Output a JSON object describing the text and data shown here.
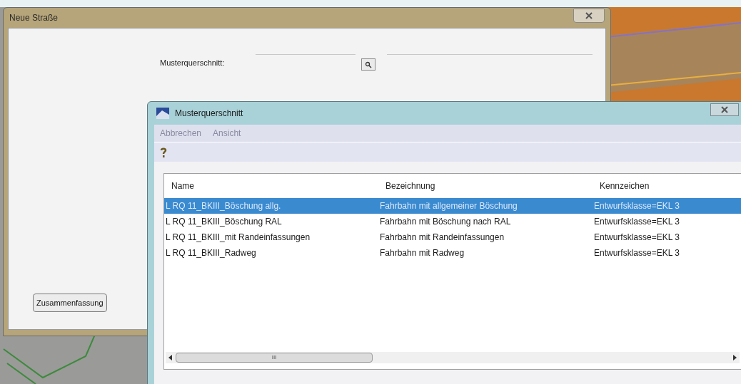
{
  "main_window": {
    "title": "Neue Straße",
    "field_label": "Musterquerschnitt:",
    "summary_button": "Zusammenfassung"
  },
  "dialog": {
    "title": "Musterquerschnitt",
    "menu": [
      "Abbrechen",
      "Ansicht"
    ],
    "table": {
      "columns": [
        "Name",
        "Bezeichnung",
        "Kennzeichen"
      ],
      "rows": [
        {
          "cells": [
            "L RQ 11_BKIII_Böschung allg.",
            "Fahrbahn mit allgemeiner Böschung",
            "Entwurfsklasse=EKL 3"
          ],
          "selected": true
        },
        {
          "cells": [
            "L RQ 11_BKIII_Böschung RAL",
            "Fahrbahn mit Böschung nach RAL",
            "Entwurfsklasse=EKL 3"
          ],
          "selected": false
        },
        {
          "cells": [
            "L RQ 11_BKIII_mit Randeinfassungen",
            "Fahrbahn mit Randeinfassungen",
            "Entwurfsklasse=EKL 3"
          ],
          "selected": false
        },
        {
          "cells": [
            "L RQ 11_BKIII_Radweg",
            "Fahrbahn mit Radweg",
            "Entwurfsklasse=EKL 3"
          ],
          "selected": false
        }
      ]
    },
    "scrollbar_grip": "III"
  }
}
